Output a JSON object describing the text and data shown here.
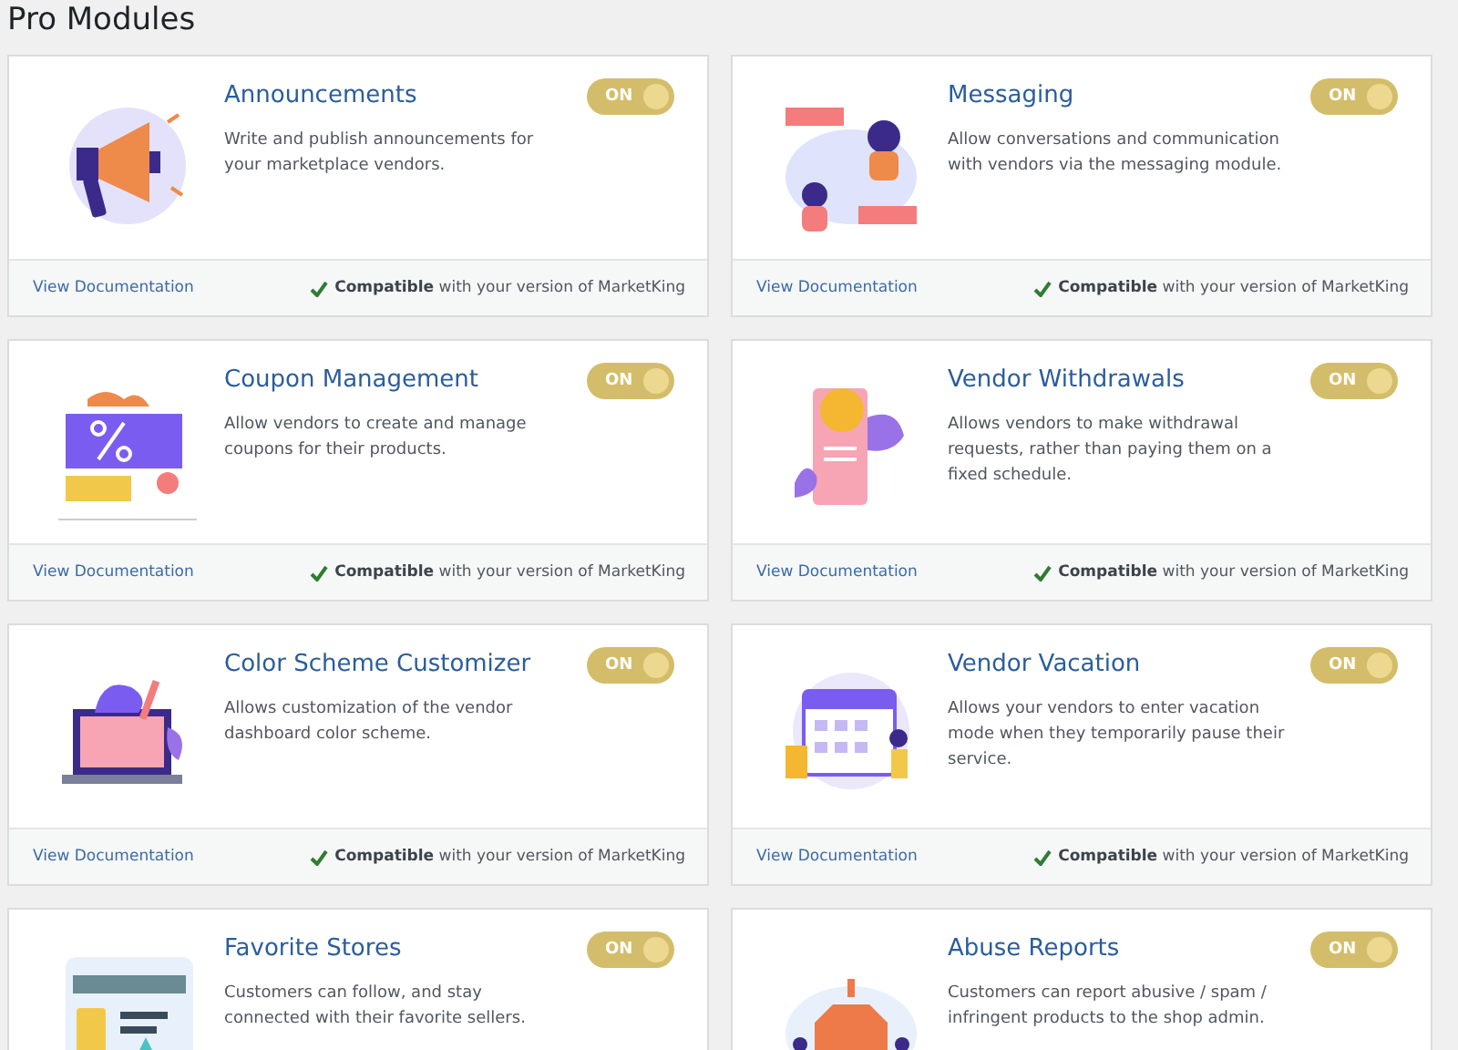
{
  "heading": "Pro Modules",
  "modules": [
    {
      "kind": "megaphone",
      "title": "Announcements",
      "description": "Write and publish announcements for your marketplace vendors.",
      "toggle": {
        "label": "ON",
        "on": true
      },
      "footer": {
        "link": "View Documentation",
        "compat": "**Compatible** with your version of MarketKing"
      }
    },
    {
      "kind": "chat",
      "title": "Messaging",
      "description": "Allow conversations and communication with vendors via the messaging module.",
      "toggle": {
        "label": "ON",
        "on": true
      },
      "footer": {
        "link": "View Documentation",
        "compat": "**Compatible** with your version of MarketKing"
      }
    },
    {
      "kind": "coupon",
      "title": "Coupon Management",
      "description": "Allow vendors to create and manage coupons for their products.",
      "toggle": {
        "label": "ON",
        "on": true
      },
      "footer": {
        "link": "View Documentation",
        "compat": "**Compatible** with your version of MarketKing"
      }
    },
    {
      "kind": "coin",
      "title": "Vendor Withdrawals",
      "description": "Allows vendors to make withdrawal requests, rather than paying them on a fixed schedule.",
      "toggle": {
        "label": "ON",
        "on": true
      },
      "footer": {
        "link": "View Documentation",
        "compat": "**Compatible** with your version of MarketKing"
      }
    },
    {
      "kind": "palette",
      "title": "Color Scheme Customizer",
      "description": "Allows customization of the vendor dashboard color scheme.",
      "toggle": {
        "label": "ON",
        "on": true
      },
      "footer": {
        "link": "View Documentation",
        "compat": "**Compatible** with your version of MarketKing"
      }
    },
    {
      "kind": "calendar",
      "title": "Vendor Vacation",
      "description": "Allows your vendors to enter vacation mode when they temporarily pause their service.",
      "toggle": {
        "label": "ON",
        "on": true
      },
      "footer": {
        "link": "View Documentation",
        "compat": "**Compatible** with your version of MarketKing"
      }
    },
    {
      "kind": "store",
      "title": "Favorite Stores",
      "description": "Customers can follow, and stay connected with their favorite sellers.",
      "toggle": {
        "label": "ON",
        "on": true
      }
    },
    {
      "kind": "stop",
      "title": "Abuse Reports",
      "description": "Customers can report abusive / spam / infringent products to the shop admin.",
      "toggle": {
        "label": "ON",
        "on": true
      }
    }
  ]
}
